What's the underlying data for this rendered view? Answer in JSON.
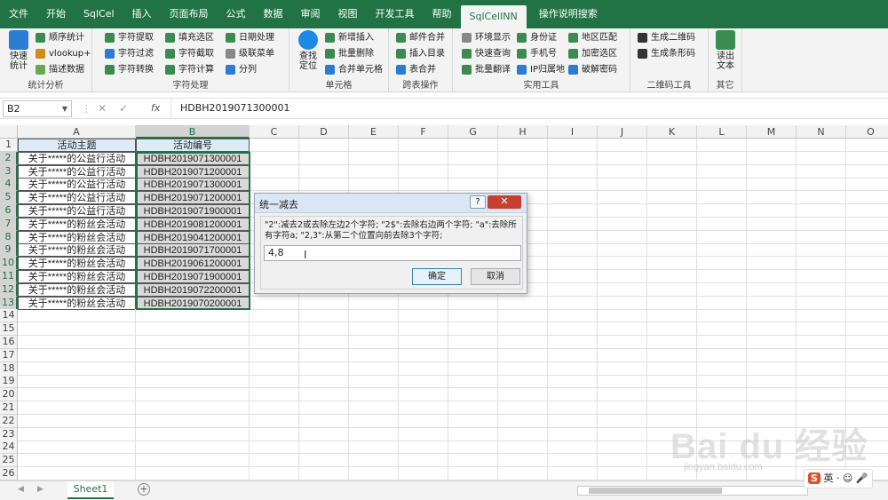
{
  "ribbon_tabs": [
    "文件",
    "开始",
    "SqlCel",
    "插入",
    "页面布局",
    "公式",
    "数据",
    "审阅",
    "视图",
    "开发工具",
    "帮助",
    "SqlCelINN",
    "操作说明搜索"
  ],
  "active_tab": "SqlCelINN",
  "groups": {
    "stats": {
      "label": "统计分析",
      "big": "快速\n统计",
      "items": [
        "顺序统计",
        "vlookup+",
        "描述数据"
      ]
    },
    "chars": {
      "label": "字符处理",
      "items": [
        "字符提取",
        "字符过滤",
        "字符转换",
        "填充选区",
        "字符截取",
        "字符计算",
        "日期处理",
        "级联菜单",
        "分列"
      ]
    },
    "cell": {
      "label": "单元格",
      "big": "查找\n定位",
      "items": [
        "新增插入",
        "批量删除",
        "合并单元格"
      ]
    },
    "cross": {
      "label": "跨表操作",
      "items": [
        "邮件合并",
        "插入目录",
        "表合并"
      ]
    },
    "util": {
      "label": "实用工具",
      "items": [
        "环境显示",
        "快速查询",
        "批量翻译",
        "身份证",
        "手机号",
        "IP归属地",
        "地区匹配",
        "加密选区",
        "破解密码"
      ]
    },
    "qr": {
      "label": "二维码工具",
      "items": [
        "生成二维码",
        "生成条形码"
      ]
    },
    "other": {
      "label": "其它",
      "big": "读出\n文本"
    }
  },
  "formula_bar": {
    "name_box": "B2",
    "fx": "fx",
    "content": "HDBH2019071300001"
  },
  "columns": [
    "A",
    "B",
    "C",
    "D",
    "E",
    "F",
    "G",
    "H",
    "I",
    "J",
    "K",
    "L",
    "M",
    "N",
    "O"
  ],
  "rows": [
    "1",
    "2",
    "3",
    "4",
    "5",
    "6",
    "7",
    "8",
    "9",
    "10",
    "11",
    "12",
    "13",
    "14",
    "15",
    "16",
    "17",
    "18",
    "19",
    "20",
    "21",
    "22",
    "23",
    "24",
    "25",
    "26"
  ],
  "header_row": [
    "活动主题",
    "活动编号"
  ],
  "data_rows": [
    [
      "关于*****的公益行活动",
      "HDBH2019071300001"
    ],
    [
      "关于*****的公益行活动",
      "HDBH2019071200001"
    ],
    [
      "关于*****的公益行活动",
      "HDBH2019071300001"
    ],
    [
      "关于*****的公益行活动",
      "HDBH2019071200001"
    ],
    [
      "关于*****的公益行活动",
      "HDBH2019071900001"
    ],
    [
      "关于*****的粉丝会活动",
      "HDBH2019081200001"
    ],
    [
      "关于*****的粉丝会活动",
      "HDBH2019041200001"
    ],
    [
      "关于*****的粉丝会活动",
      "HDBH2019071700001"
    ],
    [
      "关于*****的粉丝会活动",
      "HDBH2019061200001"
    ],
    [
      "关于*****的粉丝会活动",
      "HDBH2019071900001"
    ],
    [
      "关于*****的粉丝会活动",
      "HDBH2019072200001"
    ],
    [
      "关于*****的粉丝会活动",
      "HDBH2019070200001"
    ]
  ],
  "dialog": {
    "title": "统一减去",
    "help": "?",
    "close": "✕",
    "description": "\"2\":减去2或去除左边2个字符; \"2$\":去除右边两个字符; \"a\":去除所有字符a; \"2,3\":从第二个位置向前去除3个字符;",
    "input_value": "4,8",
    "ok": "确定",
    "cancel": "取消"
  },
  "sheet_tab": "Sheet1",
  "ime": {
    "s": "S",
    "text": "英 · ☺ 🎤"
  },
  "watermark": {
    "main": "Bai du 经验",
    "url": "jingyan.baidu.com"
  }
}
